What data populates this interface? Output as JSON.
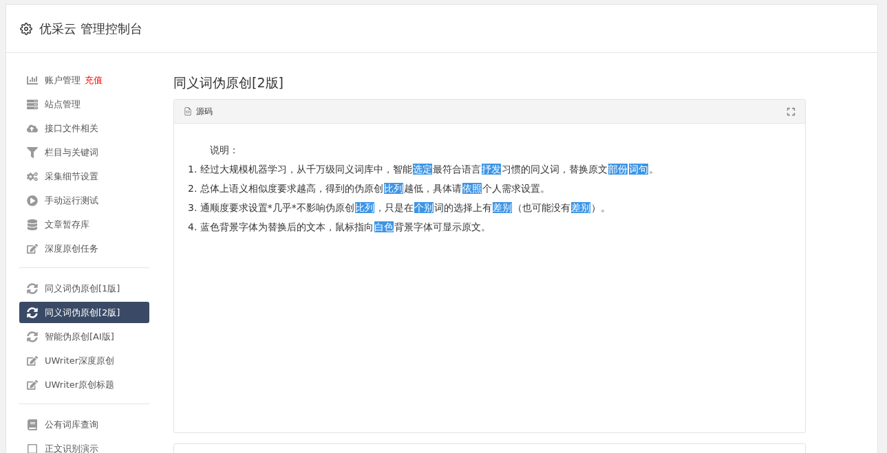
{
  "header": {
    "title": "优采云 管理控制台"
  },
  "sidebar": {
    "groups": [
      {
        "items": [
          {
            "label": "账户管理",
            "badge": "充值",
            "selected": false
          },
          {
            "label": "站点管理",
            "selected": false
          },
          {
            "label": "接口文件相关",
            "selected": false
          },
          {
            "label": "栏目与关键词",
            "selected": false
          },
          {
            "label": "采集细节设置",
            "selected": false
          },
          {
            "label": "手动运行测试",
            "selected": false
          },
          {
            "label": "文章暂存库",
            "selected": false
          },
          {
            "label": "深度原创任务",
            "selected": false
          }
        ]
      },
      {
        "items": [
          {
            "label": "同义词伪原创[1版]",
            "selected": false
          },
          {
            "label": "同义词伪原创[2版]",
            "selected": true
          },
          {
            "label": "智能伪原创[AI版]",
            "selected": false
          },
          {
            "label": "UWriter深度原创",
            "selected": false
          },
          {
            "label": "UWriter原创标题",
            "selected": false
          }
        ]
      },
      {
        "items": [
          {
            "label": "公有词库查询",
            "selected": false
          },
          {
            "label": "正文识别演示",
            "selected": false
          }
        ]
      }
    ]
  },
  "page_title": "同义词伪原创[2版]",
  "source_panel": {
    "tab": "源码",
    "heading": "说明：",
    "lines": [
      [
        {
          "text": "1. 经过大规模机器学习，从千万级同义词库中，智能",
          "replaced": false
        },
        {
          "text": "选定",
          "replaced": true
        },
        {
          "text": "最符合语言",
          "replaced": false
        },
        {
          "text": "抒发",
          "replaced": true
        },
        {
          "text": "习惯的同义词，替换原文",
          "replaced": false
        },
        {
          "text": "部份",
          "replaced": true
        },
        {
          "text": "词句",
          "replaced": true
        },
        {
          "text": "。",
          "replaced": false
        }
      ],
      [
        {
          "text": "2. 总体上语义相似度要求越高，得到的伪原创",
          "replaced": false
        },
        {
          "text": "比列",
          "replaced": true
        },
        {
          "text": "越低，具体请",
          "replaced": false
        },
        {
          "text": "依照",
          "replaced": true
        },
        {
          "text": "个人需求设置。",
          "replaced": false
        }
      ],
      [
        {
          "text": "3. 通顺度要求设置*几乎*不影响伪原创",
          "replaced": false
        },
        {
          "text": "比列",
          "replaced": true
        },
        {
          "text": "，只是在",
          "replaced": false
        },
        {
          "text": "个别",
          "replaced": true
        },
        {
          "text": "词的选择上有",
          "replaced": false
        },
        {
          "text": "差别",
          "replaced": true
        },
        {
          "text": "（也可能没有",
          "replaced": false
        },
        {
          "text": "差别",
          "replaced": true
        },
        {
          "text": "）。",
          "replaced": false
        }
      ],
      [
        {
          "text": "4. 蓝色背景字体为替换后的文本，鼠标指向",
          "replaced": false
        },
        {
          "text": "白色",
          "replaced": true
        },
        {
          "text": "背景字体可显示原文。",
          "replaced": false
        }
      ]
    ]
  }
}
